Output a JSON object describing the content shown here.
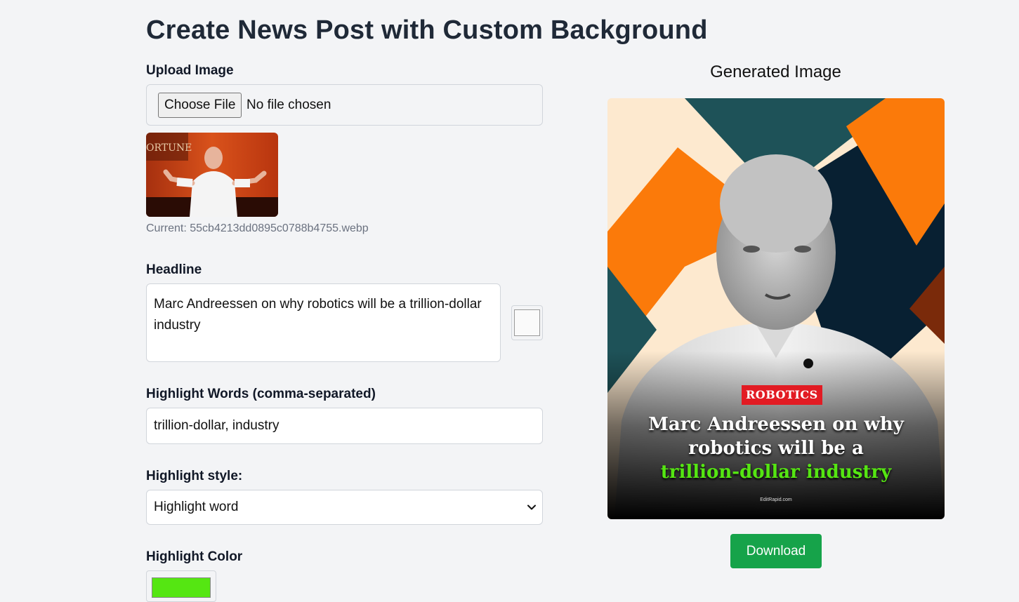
{
  "page": {
    "title": "Create News Post with Custom Background"
  },
  "upload": {
    "label": "Upload Image",
    "button_label": "Choose File",
    "status": "No file chosen",
    "current_file": "Current: 55cb4213dd0895c0788b4755.webp"
  },
  "headline": {
    "label": "Headline",
    "value": "Marc Andreessen on why robotics will be a trillion-dollar industry",
    "text_color": "#fafafa"
  },
  "highlight_words": {
    "label": "Highlight Words (comma-separated)",
    "value": "trillion-dollar, industry"
  },
  "highlight_style": {
    "label": "Highlight style:",
    "selected": "Highlight word"
  },
  "highlight_color": {
    "label": "Highlight Color",
    "value": "#55e612"
  },
  "preview": {
    "title": "Generated Image",
    "category": "ROBOTICS",
    "headline_plain": "Marc Andreessen on why robotics will be a",
    "headline_highlight": "trillion-dollar industry",
    "brand": "EditRapid.com",
    "colors": {
      "orange": "#fb7a0a",
      "teal": "#1e5258",
      "navy": "#082032",
      "cream": "#fde9cf",
      "badge": "#e21b23"
    }
  },
  "download": {
    "label": "Download"
  },
  "icons": {
    "select_chevron": "chevron-down-icon"
  }
}
